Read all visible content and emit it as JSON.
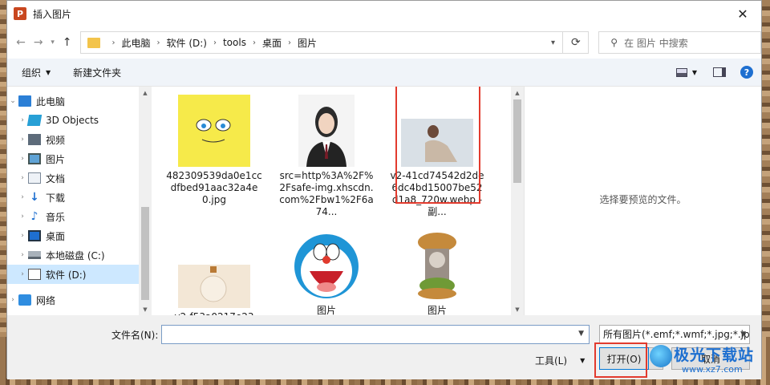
{
  "window": {
    "title": "插入图片",
    "app_icon_letter": "P",
    "close_glyph": "✕"
  },
  "address": {
    "crumbs": [
      "此电脑",
      "软件 (D:)",
      "tools",
      "桌面",
      "图片"
    ],
    "separator": "›"
  },
  "search": {
    "placeholder": "在 图片 中搜索"
  },
  "toolbar": {
    "organize_label": "组织",
    "new_folder_label": "新建文件夹"
  },
  "nav": {
    "items": [
      {
        "label": "此电脑"
      },
      {
        "label": "3D Objects"
      },
      {
        "label": "视频"
      },
      {
        "label": "图片"
      },
      {
        "label": "文档"
      },
      {
        "label": "下载"
      },
      {
        "label": "音乐"
      },
      {
        "label": "桌面"
      },
      {
        "label": "本地磁盘 (C:)"
      },
      {
        "label": "软件 (D:)"
      },
      {
        "label": "网络"
      }
    ]
  },
  "files": [
    {
      "label": "482309539da0e1ccdfbed91aac32a4e0.jpg"
    },
    {
      "label": "src=http%3A%2F%2Fsafe-img.xhscdn.com%2Fbw1%2F6a74..."
    },
    {
      "label": "v2-41cd74542d2de6dc4bd15007be52d1a8_720w.webp - 副..."
    },
    {
      "label": "v2-f53a0217e23"
    },
    {
      "label": "图片"
    },
    {
      "label": "图片"
    }
  ],
  "preview": {
    "empty_text": "选择要预览的文件。"
  },
  "bottom": {
    "filename_label": "文件名(N):",
    "filename_value": "",
    "filetype_value": "所有图片(*.emf;*.wmf;*.jpg;*.jp",
    "tools_label": "工具(L)",
    "open_label": "打开(O)",
    "cancel_label": "取消"
  },
  "watermark": {
    "title": "极光下载站",
    "url": "www.xz7.com"
  },
  "colors": {
    "highlight": "#e23b2e",
    "accent": "#0078d7",
    "selected_bg": "#cde8ff"
  }
}
